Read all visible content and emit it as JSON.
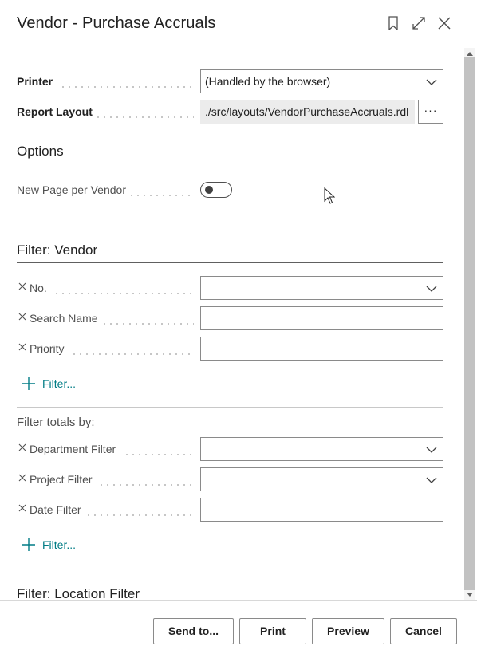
{
  "dialog": {
    "title": "Vendor - Purchase Accruals"
  },
  "titlebar_icons": [
    "bookmark-icon",
    "expand-icon",
    "close-icon"
  ],
  "printer": {
    "label": "Printer",
    "value": "(Handled by the browser)"
  },
  "report_layout": {
    "label": "Report Layout",
    "value": "./src/layouts/VendorPurchaseAccruals.rdl",
    "button_label": "···"
  },
  "options": {
    "heading": "Options",
    "new_page_per_vendor": {
      "label": "New Page per Vendor",
      "enabled": false
    }
  },
  "filter_vendor": {
    "heading": "Filter: Vendor",
    "fields": [
      {
        "label": "No.",
        "value": "",
        "type": "dropdown"
      },
      {
        "label": "Search Name",
        "value": "",
        "type": "text"
      },
      {
        "label": "Priority",
        "value": "",
        "type": "text"
      }
    ],
    "add_filter_label": "Filter..."
  },
  "filter_totals": {
    "heading": "Filter totals by:",
    "fields": [
      {
        "label": "Department Filter",
        "value": "",
        "type": "dropdown"
      },
      {
        "label": "Project Filter",
        "value": "",
        "type": "dropdown"
      },
      {
        "label": "Date Filter",
        "value": "",
        "type": "text"
      }
    ],
    "add_filter_label": "Filter..."
  },
  "filter_location": {
    "heading": "Filter: Location Filter"
  },
  "footer": {
    "send_to": "Send to...",
    "print": "Print",
    "preview": "Preview",
    "cancel": "Cancel"
  },
  "colors": {
    "accent": "#007c85",
    "text": "#212121",
    "border": "#8a8a8a"
  }
}
